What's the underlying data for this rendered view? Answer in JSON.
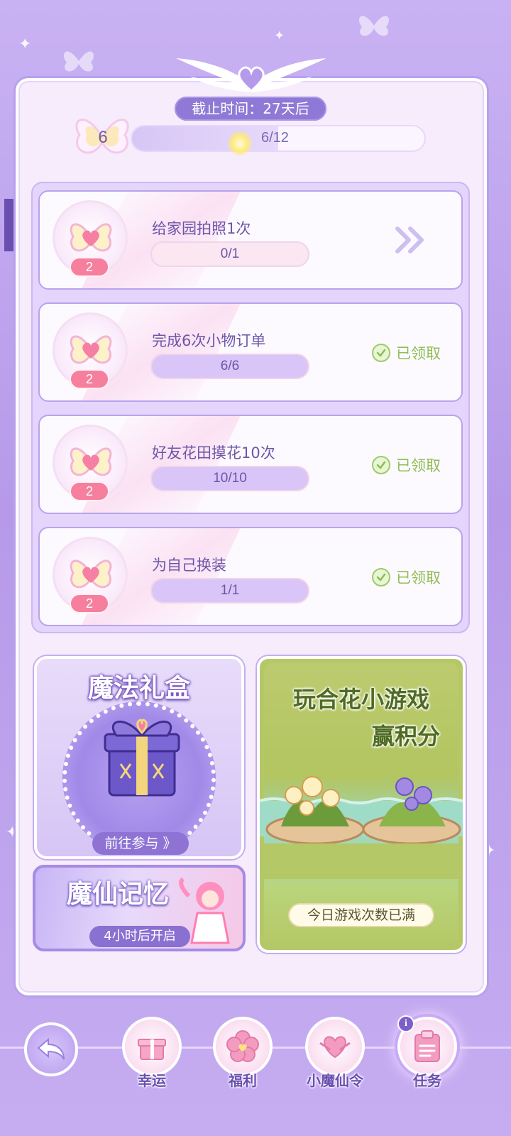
{
  "header": {
    "deadline": "截止时间：27天后",
    "level": "6",
    "progress_text": "6/12",
    "progress_fraction": 0.5
  },
  "tasks": [
    {
      "title": "给家园拍照1次",
      "progress": "0/1",
      "fraction": 0,
      "reward": "2",
      "status": "go",
      "claimed_label": ""
    },
    {
      "title": "完成6次小物订单",
      "progress": "6/6",
      "fraction": 1,
      "reward": "2",
      "status": "claimed",
      "claimed_label": "已领取"
    },
    {
      "title": "好友花田摸花10次",
      "progress": "10/10",
      "fraction": 1,
      "reward": "2",
      "status": "claimed",
      "claimed_label": "已领取"
    },
    {
      "title": "为自己换装",
      "progress": "1/1",
      "fraction": 1,
      "reward": "2",
      "status": "claimed",
      "claimed_label": "已领取"
    }
  ],
  "gift_card": {
    "title": "魔法礼盒",
    "button": "前往参与 》"
  },
  "memory_card": {
    "title": "魔仙记忆",
    "button": "4小时后开启"
  },
  "game_card": {
    "title_line1": "玩合花小游戏",
    "title_line2": "赢积分",
    "button": "今日游戏次数已满"
  },
  "nav": {
    "items": [
      {
        "label": "幸运",
        "icon": "gift-icon"
      },
      {
        "label": "福利",
        "icon": "flower-icon"
      },
      {
        "label": "小魔仙令",
        "icon": "heart-emblem-icon"
      },
      {
        "label": "任务",
        "icon": "clipboard-icon",
        "active": true
      }
    ],
    "info": "i"
  },
  "colors": {
    "accent": "#8e79d6",
    "reward_pink": "#f67f9d",
    "claimed_green": "#8fbd54",
    "text_purple": "#6c56a8"
  }
}
